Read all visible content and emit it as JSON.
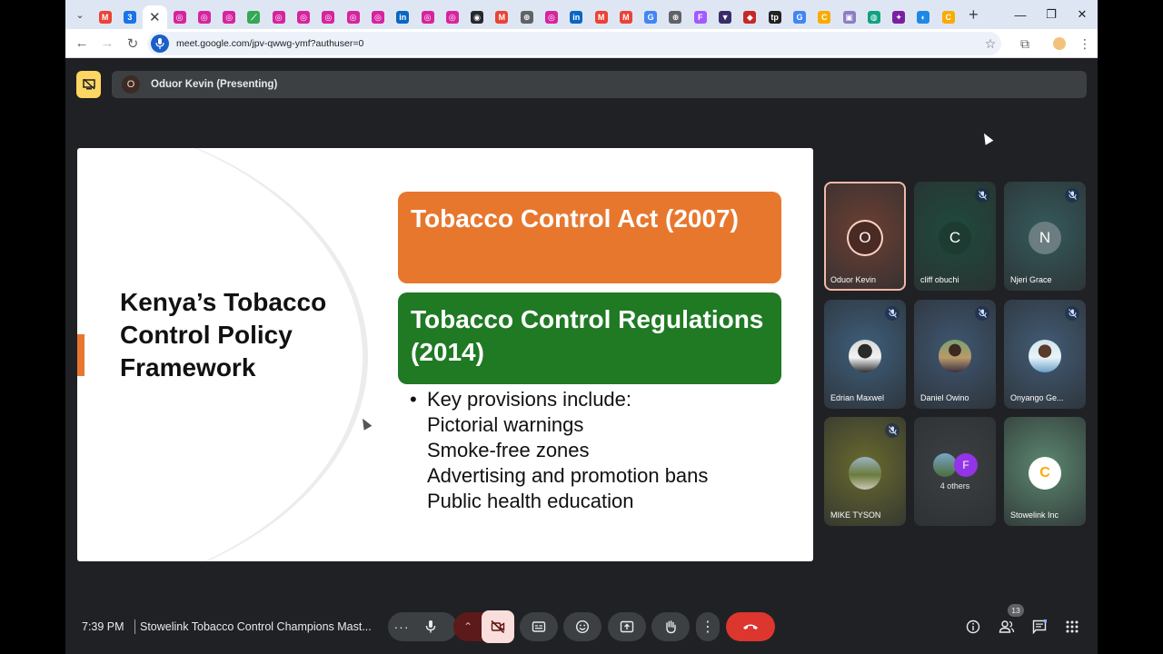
{
  "browser": {
    "tabs": [
      {
        "icon": "gmail",
        "color": "#ea4335",
        "letter": "M"
      },
      {
        "icon": "google-calendar",
        "color": "#1a73e8",
        "letter": "3"
      },
      {
        "icon": "close",
        "color": "",
        "letter": "✕",
        "active": true
      },
      {
        "icon": "instagram",
        "color": "#d6249f",
        "letter": "◎"
      },
      {
        "icon": "instagram",
        "color": "#d6249f",
        "letter": "◎"
      },
      {
        "icon": "instagram",
        "color": "#d6249f",
        "letter": "◎"
      },
      {
        "icon": "google-photos",
        "color": "#34a853",
        "letter": "⟋"
      },
      {
        "icon": "instagram",
        "color": "#d6249f",
        "letter": "◎"
      },
      {
        "icon": "instagram",
        "color": "#d6249f",
        "letter": "◎"
      },
      {
        "icon": "instagram",
        "color": "#d6249f",
        "letter": "◎"
      },
      {
        "icon": "instagram",
        "color": "#d6249f",
        "letter": "◎"
      },
      {
        "icon": "instagram",
        "color": "#d6249f",
        "letter": "◎"
      },
      {
        "icon": "linkedin",
        "color": "#0a66c2",
        "letter": "in"
      },
      {
        "icon": "instagram",
        "color": "#d6249f",
        "letter": "◎"
      },
      {
        "icon": "instagram",
        "color": "#d6249f",
        "letter": "◎"
      },
      {
        "icon": "github",
        "color": "#24292e",
        "letter": "◉"
      },
      {
        "icon": "gmail",
        "color": "#ea4335",
        "letter": "M"
      },
      {
        "icon": "globe",
        "color": "#5f6368",
        "letter": "⊕"
      },
      {
        "icon": "instagram",
        "color": "#d6249f",
        "letter": "◎"
      },
      {
        "icon": "linkedin",
        "color": "#0a66c2",
        "letter": "in"
      },
      {
        "icon": "gmail",
        "color": "#ea4335",
        "letter": "M"
      },
      {
        "icon": "gmail",
        "color": "#ea4335",
        "letter": "M"
      },
      {
        "icon": "google",
        "color": "#4285f4",
        "letter": "G"
      },
      {
        "icon": "globe",
        "color": "#5f6368",
        "letter": "⊕"
      },
      {
        "icon": "figma",
        "color": "#a259ff",
        "letter": "F"
      },
      {
        "icon": "app-shield",
        "color": "#3a2c6b",
        "letter": "▼"
      },
      {
        "icon": "app-red",
        "color": "#c62828",
        "letter": "◆"
      },
      {
        "icon": "wattpad",
        "color": "#222",
        "letter": "tp"
      },
      {
        "icon": "google",
        "color": "#4285f4",
        "letter": "G"
      },
      {
        "icon": "chrome-like",
        "color": "#f9ab00",
        "letter": "C"
      },
      {
        "icon": "docs-web",
        "color": "#8e7cc3",
        "letter": "▣"
      },
      {
        "icon": "chatgpt",
        "color": "#10a37f",
        "letter": "◍"
      },
      {
        "icon": "app-chat",
        "color": "#7b1fa2",
        "letter": "✦"
      },
      {
        "icon": "drive",
        "color": "#1e88e5",
        "letter": "◐"
      },
      {
        "icon": "chrome-like",
        "color": "#f9ab00",
        "letter": "C"
      }
    ],
    "url": "meet.google.com/jpv-qwwg-ymf?authuser=0"
  },
  "meet": {
    "presenter_initial": "O",
    "presenter_label": "Oduor Kevin (Presenting)",
    "slide": {
      "title": "Kenya’s Tobacco Control Policy Framework",
      "box1": "Tobacco Control Act (2007)",
      "box2": "Tobacco Control Regulations (2014)",
      "intro": "Key provisions include:",
      "provisions": [
        "Pictorial warnings",
        "Smoke-free zones",
        "Advertising and promotion bans",
        "Public health education"
      ]
    },
    "participants": [
      {
        "name": "Oduor Kevin",
        "initial": "O",
        "muted": false,
        "bg": "#6d3f33",
        "avatar_bg": "#4a2a22",
        "speaking": true
      },
      {
        "name": "cliff obuchi",
        "initial": "C",
        "muted": true,
        "bg": "#1f4a3c",
        "avatar_bg": "#1d3b31"
      },
      {
        "name": "Njeri Grace",
        "initial": "N",
        "muted": true,
        "bg": "#355a5c",
        "avatar_bg": "#6b7d80"
      },
      {
        "name": "Edrian Maxwel",
        "initial": "",
        "muted": true,
        "bg": "#3e5f7c",
        "photo": "person-dark"
      },
      {
        "name": "Daniel Owino",
        "initial": "",
        "muted": true,
        "bg": "#3f5772",
        "photo": "person-suit"
      },
      {
        "name": "Onyango Ge...",
        "initial": "",
        "muted": true,
        "bg": "#425c76",
        "photo": "person-outdoor"
      },
      {
        "name": "MIKE TYSON",
        "initial": "",
        "muted": true,
        "bg": "#6a6a2e",
        "photo": "group-field"
      },
      {
        "name": "4 others",
        "initial": "F",
        "muted": false,
        "bg": "#3c4043",
        "others": true
      },
      {
        "name": "Stowelink Inc",
        "initial": "",
        "muted": false,
        "bg": "#5c8870",
        "photo": "logo"
      }
    ],
    "others_initial": "F",
    "clock": "7:39 PM",
    "meeting_name": "Stowelink Tobacco Control Champions Mast...",
    "people_count": "13"
  }
}
